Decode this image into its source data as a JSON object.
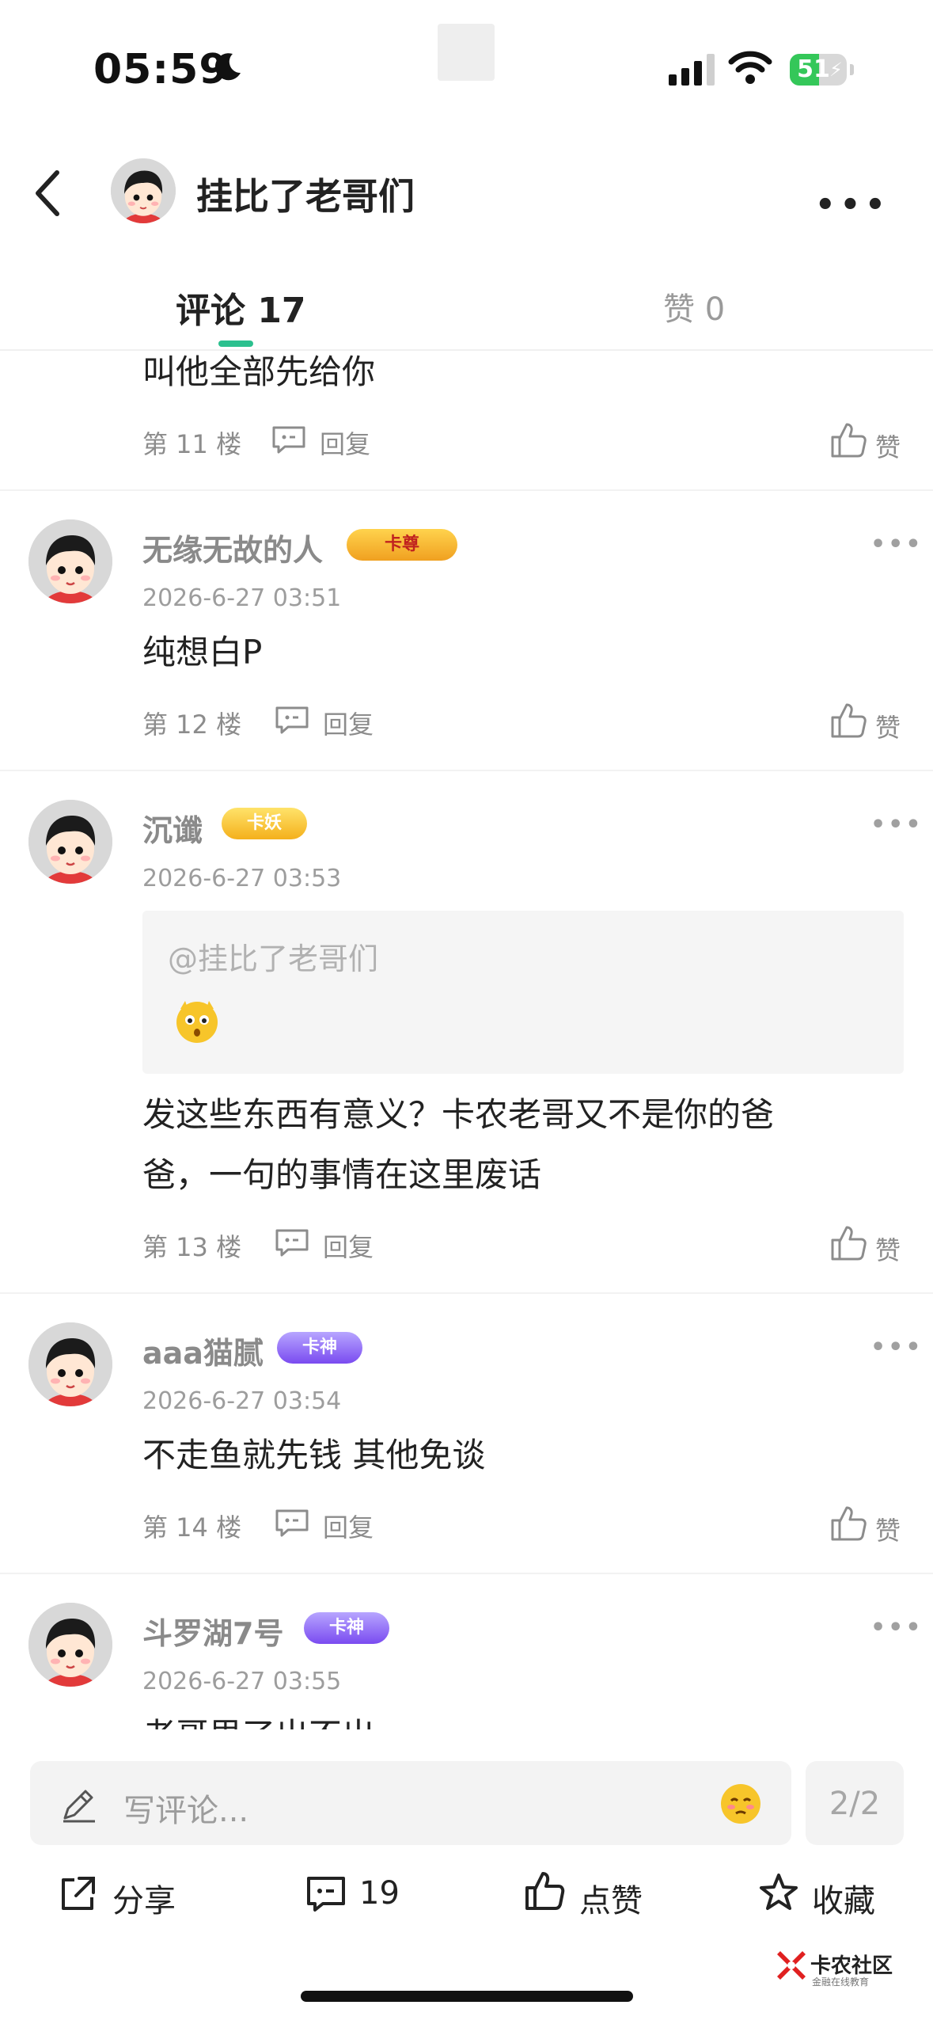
{
  "status_bar": {
    "time": "05:59",
    "battery": "51"
  },
  "header": {
    "title": "挂比了老哥们"
  },
  "tabs": {
    "comments": "评论 17",
    "likes": "赞 0"
  },
  "comments": [
    {
      "text": "叫他全部先给你",
      "floor": "第 11 楼",
      "reply": "回复",
      "like": "赞"
    },
    {
      "username": "无缘无故的人",
      "badge": "卡尊",
      "time": "2026-6-27 03:51",
      "text": "纯想白P",
      "floor": "第 12 楼",
      "reply": "回复",
      "like": "赞"
    },
    {
      "username": "沉谶",
      "badge": "卡妖",
      "time": "2026-6-27 03:53",
      "quote": "@挂比了老哥们",
      "text_lines": [
        "发这些东西有意义？卡农老哥又不是你的爸",
        "爸，一句的事情在这里废话"
      ],
      "floor": "第 13 楼",
      "reply": "回复",
      "like": "赞"
    },
    {
      "username": "aaa猫腻",
      "badge": "卡神",
      "time": "2026-6-27 03:54",
      "text": "不走鱼就先钱 其他免谈",
      "floor": "第 14 楼",
      "reply": "回复",
      "like": "赞"
    },
    {
      "username": "斗罗湖7号",
      "badge": "卡神",
      "time": "2026-6-27 03:55",
      "text": "老哥思了出不出"
    }
  ],
  "input": {
    "placeholder": "写评论...",
    "page": "2/2"
  },
  "actions": {
    "share": "分享",
    "comments_count": "19",
    "like": "点赞",
    "favorite": "收藏"
  },
  "watermark": {
    "name": "卡农社区",
    "sub": "金融在线教育"
  },
  "colors": {
    "accent": "#2bc08e",
    "battery": "#34c759"
  }
}
